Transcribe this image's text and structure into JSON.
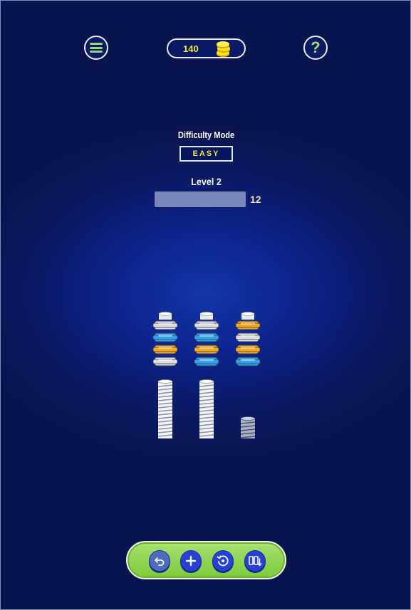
{
  "header": {
    "menu_icon": "hamburger-menu-icon",
    "coins": "140",
    "coin_icon": "coin-stack-icon",
    "help_icon": "question-mark-icon",
    "help_glyph": "?"
  },
  "difficulty": {
    "label": "Difficulty Mode",
    "value": "EASY"
  },
  "level": {
    "label": "Level 2",
    "progress": 0.0,
    "moves": "12"
  },
  "board": {
    "colors": {
      "white": "#dadde2",
      "blue": "#2aa3f0",
      "orange": "#f5a81c"
    },
    "stacks": [
      [
        "white",
        "blue",
        "orange",
        "white"
      ],
      [
        "white",
        "blue",
        "orange",
        "blue"
      ],
      [
        "orange",
        "white",
        "orange",
        "blue"
      ]
    ],
    "bolts": [
      "tall",
      "tall",
      "short"
    ]
  },
  "toolbar": {
    "undo_icon": "undo-icon",
    "add_icon": "add-bolt-icon",
    "restart_icon": "restart-icon",
    "swap_icon": "swap-icon"
  }
}
